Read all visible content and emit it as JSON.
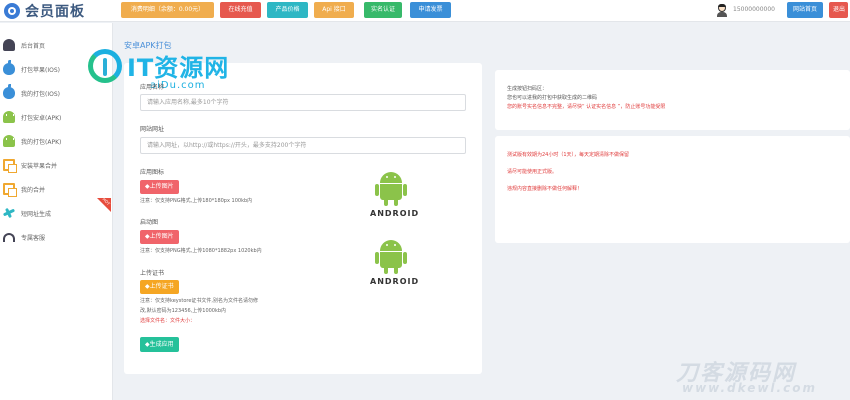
{
  "header": {
    "brand_title": "会员面板",
    "buttons": [
      {
        "label": "消费明细（余额：0.00元）",
        "color": "#f0ad4e"
      },
      {
        "label": "在线充值",
        "color": "#e6584e"
      },
      {
        "label": "产品价格",
        "color": "#2eb7c4"
      },
      {
        "label": "Api 接口",
        "color": "#f0ad4e"
      },
      {
        "label": "实名认证",
        "color": "#37b96a"
      },
      {
        "label": "申请发票",
        "color": "#3a8fd8"
      }
    ],
    "user_phone": "15000000000",
    "home_button": "网站首页",
    "exit_button": "退出"
  },
  "sidebar": {
    "items": [
      {
        "label": "后台首页",
        "icon": "dashboard-icon"
      },
      {
        "label": "打包苹果(IOS)",
        "icon": "apple-icon"
      },
      {
        "label": "我的打包(IOS)",
        "icon": "apple-icon"
      },
      {
        "label": "打包安卓(APK)",
        "icon": "android-icon"
      },
      {
        "label": "我的打包(APK)",
        "icon": "android-icon"
      },
      {
        "label": "安装苹果合并",
        "icon": "pages-icon"
      },
      {
        "label": "我的合并",
        "icon": "pages-icon"
      },
      {
        "label": "短网址生成",
        "icon": "plane-icon",
        "badge": "HOT"
      },
      {
        "label": "专属客服",
        "icon": "headset-icon"
      }
    ]
  },
  "main": {
    "page_title": "安卓APK打包",
    "watermark": {
      "text": "IT资源网",
      "sub": "aiDu.com"
    },
    "app_name": {
      "label": "应用名称",
      "placeholder": "请输入应用名称,最多10个字符"
    },
    "website": {
      "label": "网站网址",
      "placeholder": "请输入网址，以http://或https://开头，最多支持200个字符"
    },
    "app_icon": {
      "label": "应用图标",
      "button": "◆上传图片",
      "note": "注意：仅支持PNG格式,上传180*180px 100kb内"
    },
    "splash": {
      "label": "启动图",
      "button": "◆上传图片",
      "note": "注意：仅支持PNG格式,上传1080*1882px 1020kb内"
    },
    "certificate": {
      "label": "上传证书",
      "button": "◆上传证书",
      "note_line1": "注意：仅支持keystore证书文件,别名为文件名请勿修",
      "note_line2": "改,默认密码为123456,上传1000kb内",
      "selected_file": "选择文件名：文件大小："
    },
    "android_word": "ANDROID",
    "submit_button": "◆生成应用"
  },
  "right_panel": {
    "top_lines": [
      {
        "text": "生成按钮扫码区：",
        "color": "gray"
      },
      {
        "text": "您也可以进我的打包中获取生成的二维码",
        "color": "gray"
      },
      {
        "text": "您的账号实名信息不完整，请尽快“ 认证实名信息 ”，防止账号功能受限",
        "color": "red"
      }
    ],
    "bottom_lines": [
      "测试版有效期为24小时（1天），每天定期清除不做保留",
      "请尽可能使用正式版。",
      "违规内容直接删除不做任何解释！"
    ]
  },
  "footer_watermark": {
    "text": "刀客源码网",
    "url": "www.dkewl.com"
  }
}
